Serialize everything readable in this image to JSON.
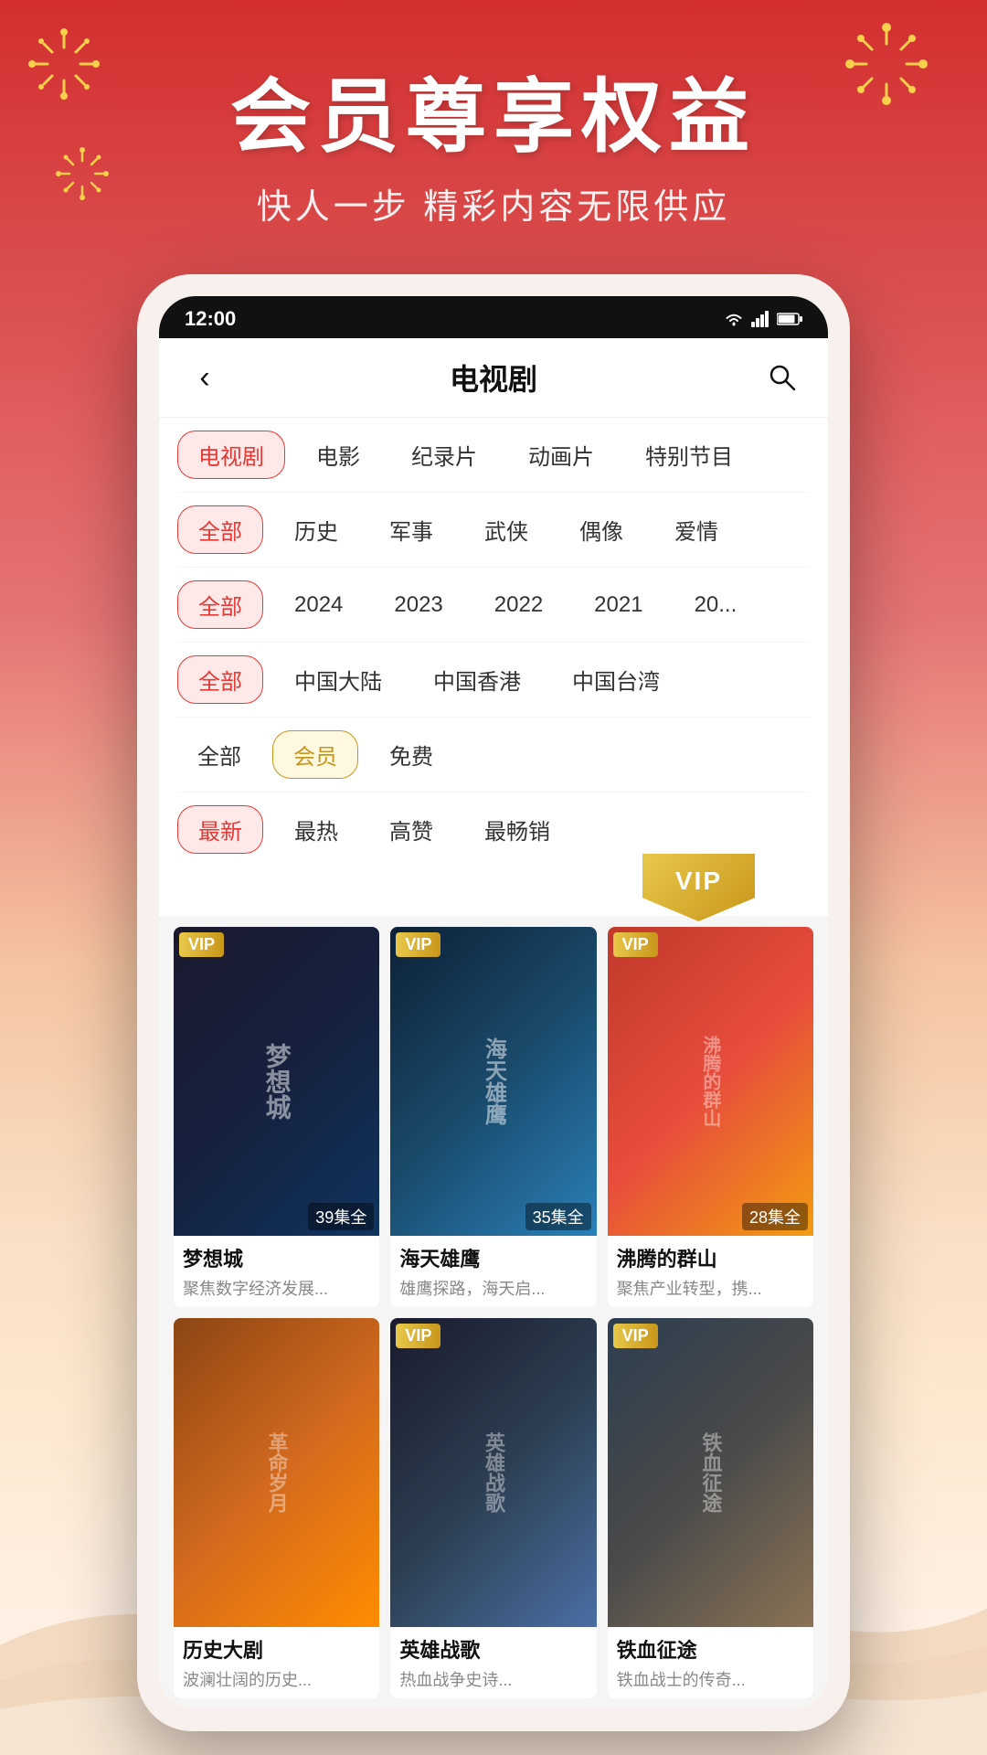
{
  "background": {
    "gradient_start": "#d32f2f",
    "gradient_end": "#fff5ee"
  },
  "hero": {
    "title": "会员尊享权益",
    "subtitle": "快人一步  精彩内容无限供应"
  },
  "status_bar": {
    "time": "12:00",
    "signal_icon": "signal",
    "wifi_icon": "wifi",
    "battery_icon": "battery"
  },
  "nav": {
    "title": "电视剧",
    "back_label": "‹",
    "search_label": "🔍"
  },
  "filters": {
    "row1": {
      "items": [
        "电视剧",
        "电影",
        "纪录片",
        "动画片",
        "特别节目"
      ],
      "active_index": 0
    },
    "row2": {
      "items": [
        "全部",
        "历史",
        "军事",
        "武侠",
        "偶像",
        "爱情"
      ],
      "active_index": 0
    },
    "row3": {
      "items": [
        "全部",
        "2024",
        "2023",
        "2022",
        "2021",
        "20..."
      ],
      "active_index": 0
    },
    "row4": {
      "items": [
        "全部",
        "中国大陆",
        "中国香港",
        "中国台湾"
      ],
      "active_index": 0
    },
    "row5": {
      "items": [
        "全部",
        "会员",
        "免费"
      ],
      "active_index": 1
    },
    "row6": {
      "items": [
        "最新",
        "最热",
        "高赞",
        "最畅销"
      ],
      "active_index": 0
    }
  },
  "vip_banner": {
    "label": "VIP"
  },
  "content": {
    "cards": [
      {
        "id": 1,
        "title": "梦想城",
        "desc": "聚焦数字经济发展...",
        "badge": "VIP",
        "episodes": "39集全",
        "thumb_class": "thumb-1",
        "thumb_text": "梦想城"
      },
      {
        "id": 2,
        "title": "海天雄鹰",
        "desc": "雄鹰探路，海天启...",
        "badge": "VIP",
        "episodes": "35集全",
        "thumb_class": "thumb-2",
        "thumb_text": "海天雄鹰"
      },
      {
        "id": 3,
        "title": "沸腾的群山",
        "desc": "聚焦产业转型，携...",
        "badge": "VIP",
        "episodes": "28集全",
        "thumb_class": "thumb-3",
        "thumb_text": "沸腾的群山"
      },
      {
        "id": 4,
        "title": "历史大剧",
        "desc": "波澜壮阔的历史...",
        "badge": "",
        "episodes": "",
        "thumb_class": "thumb-4",
        "thumb_text": ""
      },
      {
        "id": 5,
        "title": "英雄战歌",
        "desc": "热血战争史诗...",
        "badge": "VIP",
        "episodes": "",
        "thumb_class": "thumb-5",
        "thumb_text": ""
      },
      {
        "id": 6,
        "title": "铁血征途",
        "desc": "铁血战士的传奇...",
        "badge": "VIP",
        "episodes": "",
        "thumb_class": "thumb-6",
        "thumb_text": ""
      }
    ]
  }
}
